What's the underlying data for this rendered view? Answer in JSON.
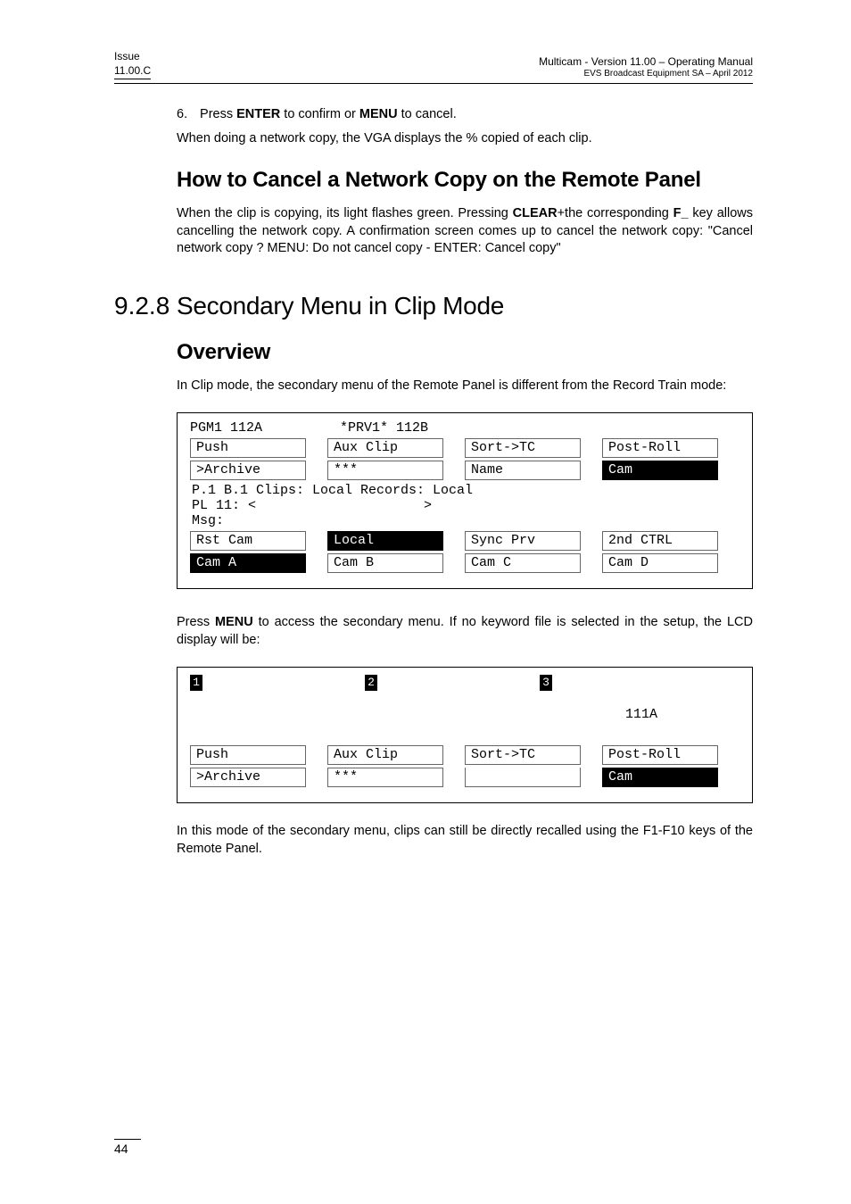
{
  "header": {
    "left_line1": "Issue",
    "left_line2": "11.00.C",
    "right_line1": "Multicam - Version 11.00 – Operating Manual",
    "right_line2": "EVS Broadcast Equipment SA – April 2012"
  },
  "step6": {
    "num": "6.",
    "text_a": "Press ",
    "bold1": "ENTER",
    "text_b": " to confirm or ",
    "bold2": "MENU",
    "text_c": " to cancel."
  },
  "para_netcopy": "When doing a network copy, the VGA displays the % copied of each clip.",
  "h_cancel": "How to Cancel a Network Copy on the Remote Panel",
  "para_cancel_a": "When the clip is copying, its light flashes green. Pressing ",
  "para_cancel_bold1": "CLEAR",
  "para_cancel_b": "+the corresponding ",
  "para_cancel_bold2": "F_",
  "para_cancel_c": " key allows cancelling the network copy. A confirmation screen comes up to cancel the network copy: \"Cancel network copy ? MENU: Do not cancel copy - ENTER: Cancel copy\"",
  "secnum": "9.2.8",
  "h_chapter": "Secondary Menu in Clip Mode",
  "h_overview": "Overview",
  "para_overview": "In Clip mode, the secondary menu of the Remote Panel is different from the Record Train mode:",
  "lcd1": {
    "head_l": "PGM1 112A",
    "head_r": "*PRV1* 112B",
    "row1": [
      "Push",
      "Aux Clip",
      "Sort->TC",
      "Post-Roll"
    ],
    "row2": [
      ">Archive",
      "***",
      "Name",
      "Cam"
    ],
    "line1": "P.1 B.1 Clips: Local  Records: Local",
    "line2a": "PL 11: <",
    "line2b": ">",
    "line3": "Msg:",
    "row3": [
      "Rst Cam",
      "Local",
      "Sync Prv",
      "2nd CTRL"
    ],
    "row4": [
      "Cam A",
      "Cam B",
      "Cam C",
      "Cam D"
    ]
  },
  "para_menu_a": "Press ",
  "para_menu_bold": "MENU",
  "para_menu_b": " to access the secondary menu. If no keyword file is selected in the setup, the LCD display will be:",
  "lcd2": {
    "kw": [
      "1",
      "2",
      "3"
    ],
    "right": "111A",
    "row1": [
      "Push",
      "Aux Clip",
      "Sort->TC",
      "Post-Roll"
    ],
    "row2": [
      ">Archive",
      "***",
      "",
      "Cam"
    ]
  },
  "para_final": "In this mode of the secondary menu, clips can still be directly recalled using the F1-F10 keys of the Remote Panel.",
  "page_number": "44"
}
